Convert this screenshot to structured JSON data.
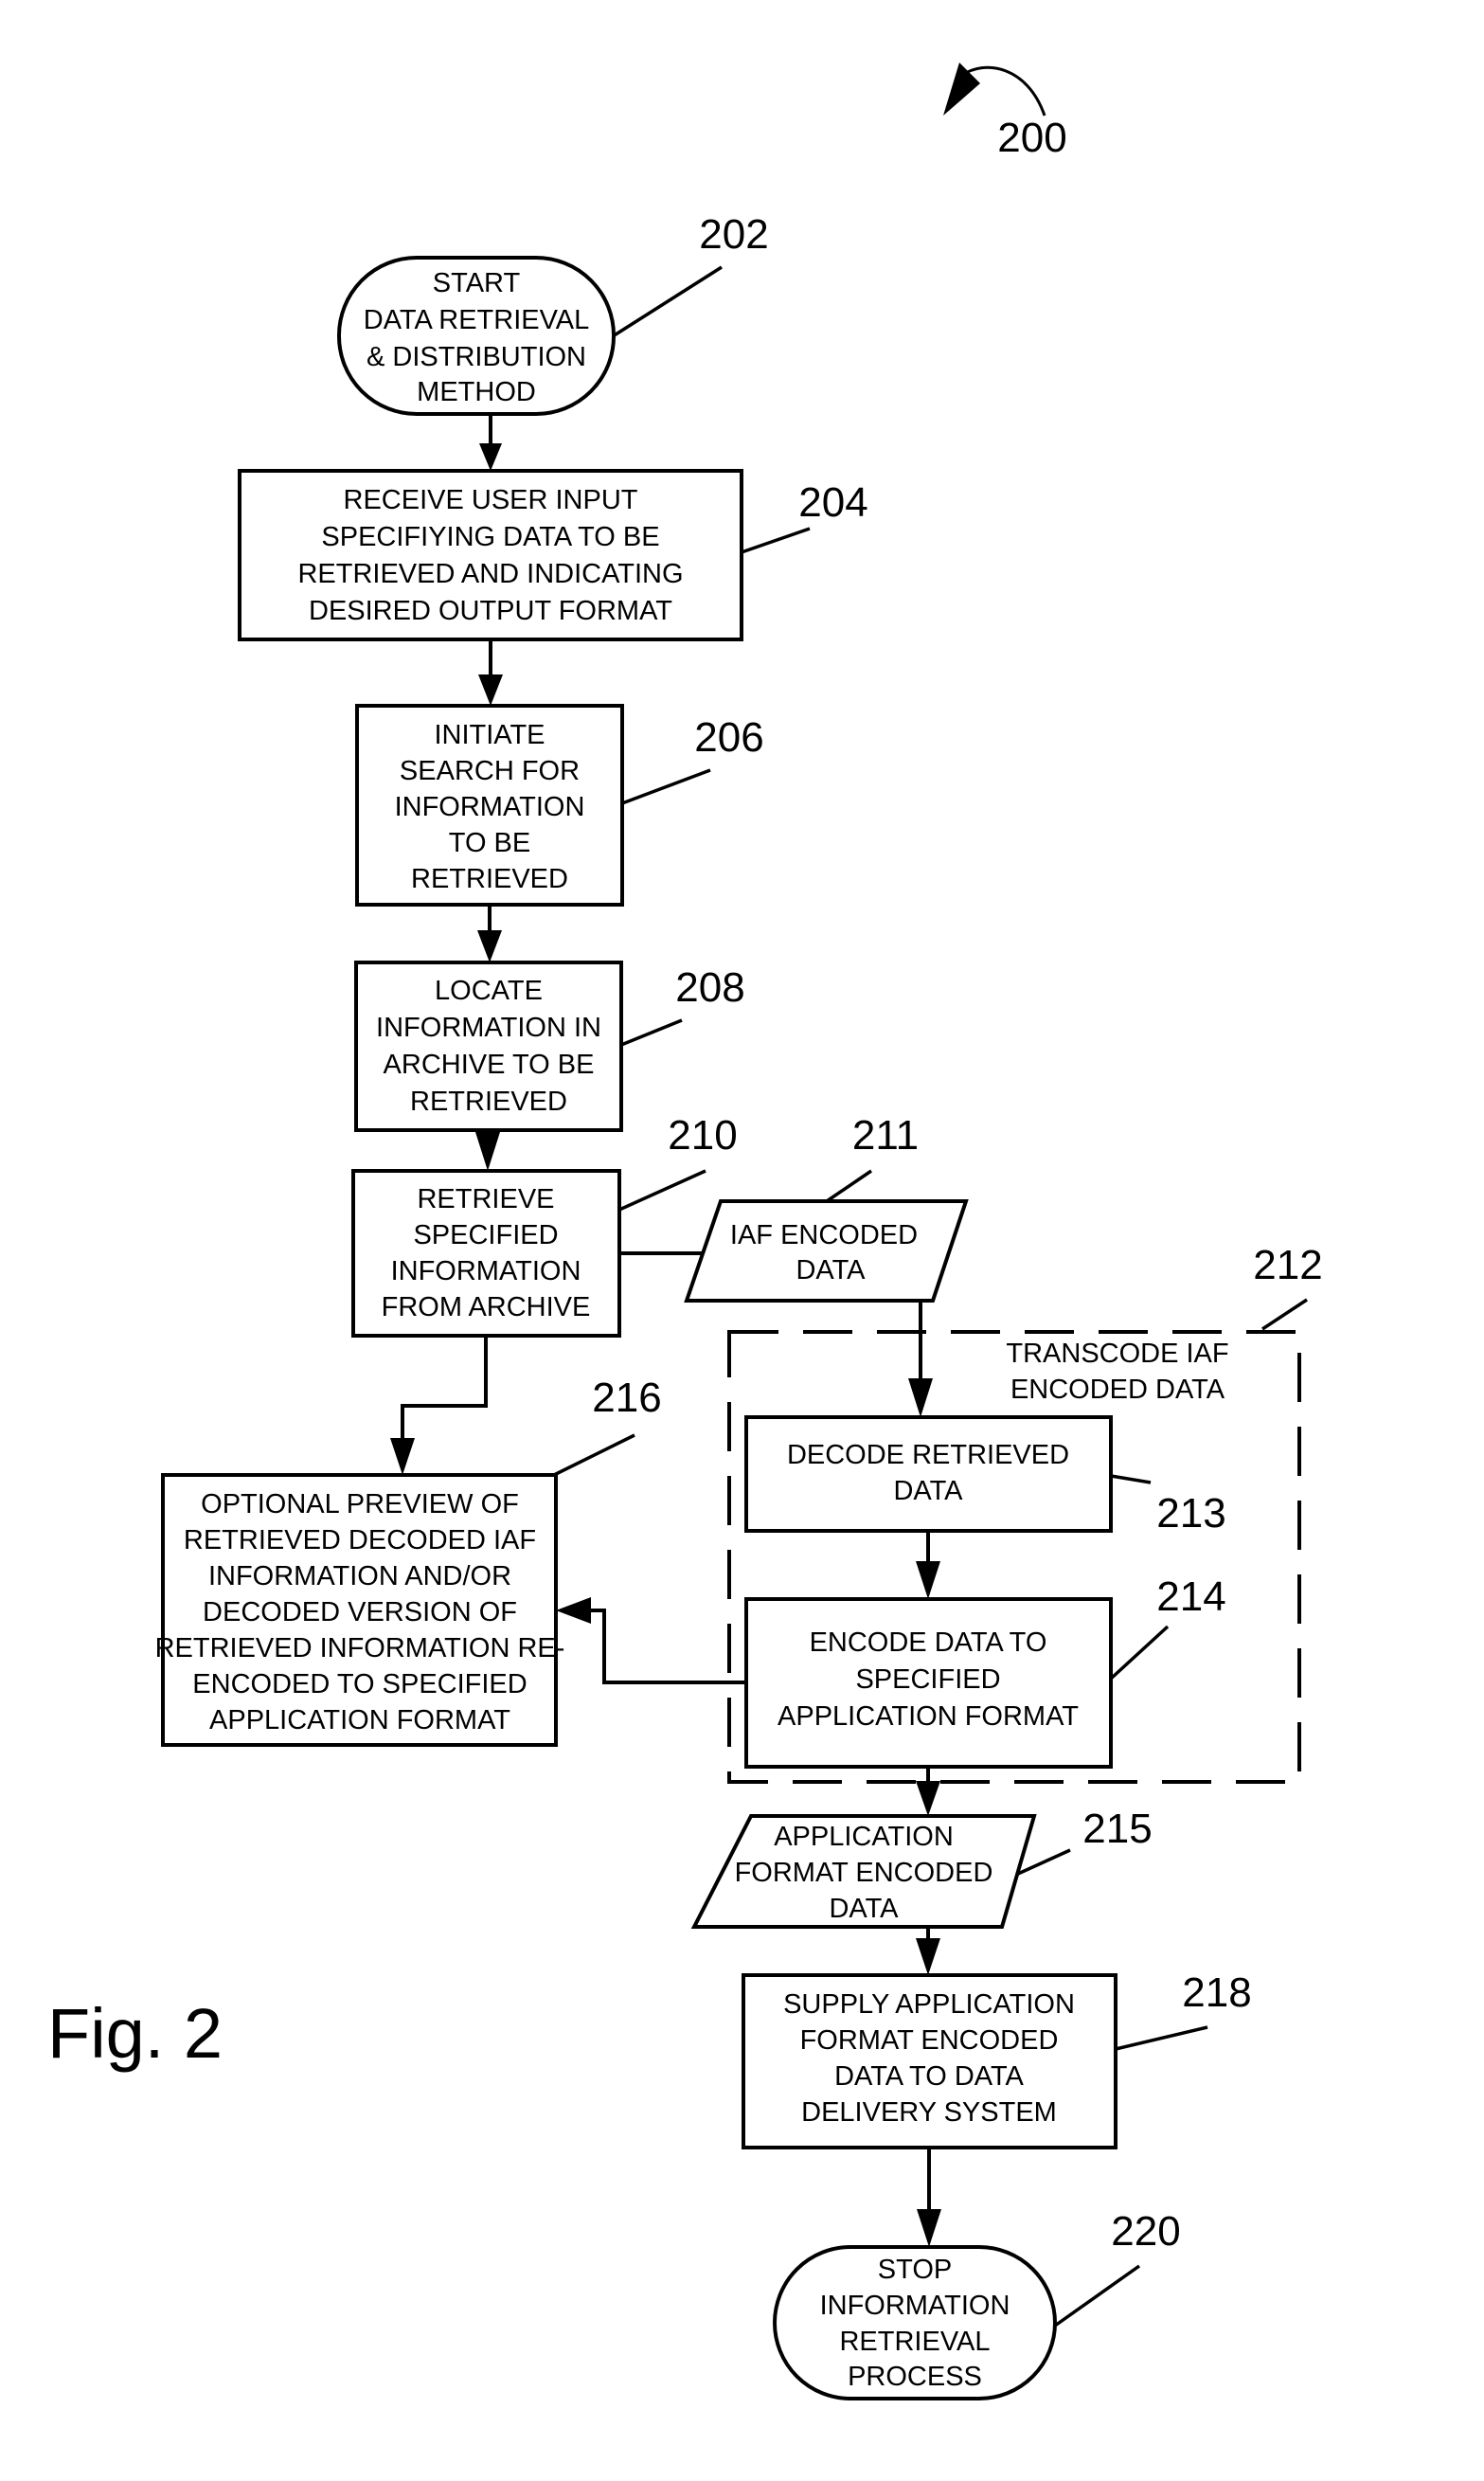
{
  "figure": {
    "label": "Fig. 2",
    "reference": "200"
  },
  "nodes": {
    "n202": {
      "ref": "202",
      "type": "terminator",
      "lines": [
        "START",
        "DATA RETRIEVAL",
        "& DISTRIBUTION",
        "METHOD"
      ]
    },
    "n204": {
      "ref": "204",
      "type": "process",
      "lines": [
        "RECEIVE USER INPUT",
        "SPECIFIYING DATA TO BE",
        "RETRIEVED AND INDICATING",
        "DESIRED OUTPUT FORMAT"
      ]
    },
    "n206": {
      "ref": "206",
      "type": "process",
      "lines": [
        "INITIATE",
        "SEARCH FOR",
        "INFORMATION",
        "TO BE",
        "RETRIEVED"
      ]
    },
    "n208": {
      "ref": "208",
      "type": "process",
      "lines": [
        "LOCATE",
        "INFORMATION IN",
        "ARCHIVE TO BE",
        "RETRIEVED"
      ]
    },
    "n210": {
      "ref": "210",
      "type": "process",
      "lines": [
        "RETRIEVE",
        "SPECIFIED",
        "INFORMATION",
        "FROM ARCHIVE"
      ]
    },
    "n211": {
      "ref": "211",
      "type": "data",
      "lines": [
        "IAF ENCODED",
        "DATA"
      ]
    },
    "n212": {
      "ref": "212",
      "type": "group",
      "lines": [
        "TRANSCODE IAF",
        "ENCODED DATA"
      ]
    },
    "n213": {
      "ref": "213",
      "type": "process",
      "lines": [
        "DECODE RETRIEVED",
        "DATA"
      ]
    },
    "n214": {
      "ref": "214",
      "type": "process",
      "lines": [
        "ENCODE DATA TO",
        "SPECIFIED",
        "APPLICATION FORMAT"
      ]
    },
    "n215": {
      "ref": "215",
      "type": "data",
      "lines": [
        "APPLICATION",
        "FORMAT ENCODED",
        "DATA"
      ]
    },
    "n216": {
      "ref": "216",
      "type": "process",
      "lines": [
        "OPTIONAL PREVIEW OF",
        "RETRIEVED  DECODED IAF",
        "INFORMATION AND/OR",
        "DECODED VERSION OF",
        "RETRIEVED INFORMATION RE-",
        "ENCODED TO SPECIFIED",
        "APPLICATION FORMAT"
      ]
    },
    "n218": {
      "ref": "218",
      "type": "process",
      "lines": [
        "SUPPLY APPLICATION",
        "FORMAT ENCODED",
        "DATA TO DATA",
        "DELIVERY SYSTEM"
      ]
    },
    "n220": {
      "ref": "220",
      "type": "terminator",
      "lines": [
        "STOP",
        "INFORMATION",
        "RETRIEVAL",
        "PROCESS"
      ]
    }
  },
  "edges": [
    [
      "202",
      "204"
    ],
    [
      "204",
      "206"
    ],
    [
      "206",
      "208"
    ],
    [
      "208",
      "210"
    ],
    [
      "210",
      "211"
    ],
    [
      "210",
      "216"
    ],
    [
      "211",
      "213"
    ],
    [
      "213",
      "214"
    ],
    [
      "214",
      "216"
    ],
    [
      "214",
      "215"
    ],
    [
      "215",
      "218"
    ],
    [
      "218",
      "220"
    ]
  ]
}
